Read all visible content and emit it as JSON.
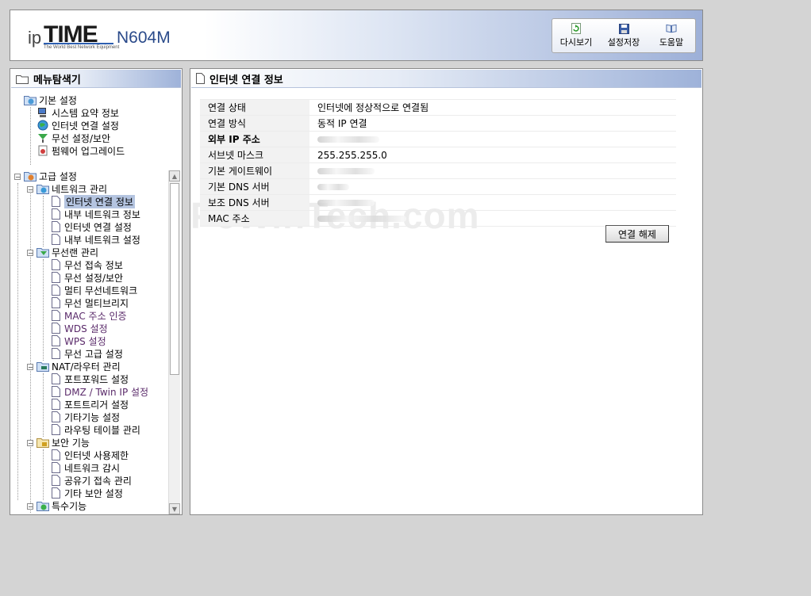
{
  "brand": {
    "prefix": "ip",
    "name": "TIME",
    "model": "N604M",
    "tagline": "The World Best Network Equipment"
  },
  "toolbar": {
    "refresh": "다시보기",
    "save": "설정저장",
    "help": "도움말"
  },
  "sidebar": {
    "title": "메뉴탐색기",
    "basic": {
      "label": "기본 설정",
      "items": [
        "시스템 요약 정보",
        "인터넷 연결 설정",
        "무선 설정/보안",
        "펌웨어 업그레이드"
      ]
    },
    "advanced": {
      "label": "고급 설정",
      "network": {
        "label": "네트워크 관리",
        "items": [
          "인터넷 연결 정보",
          "내부 네트워크 정보",
          "인터넷 연결 설정",
          "내부 네트워크 설정"
        ]
      },
      "wireless": {
        "label": "무선랜 관리",
        "items": [
          "무선 접속 정보",
          "무선 설정/보안",
          "멀티 무선네트워크",
          "무선 멀티브리지",
          "MAC 주소 인증",
          "WDS 설정",
          "WPS 설정",
          "무선 고급 설정"
        ]
      },
      "nat": {
        "label": "NAT/라우터 관리",
        "items": [
          "포트포워드 설정",
          "DMZ / Twin IP 설정",
          "포트트리거 설정",
          "기타기능 설정",
          "라우팅 테이블 관리"
        ]
      },
      "security": {
        "label": "보안 기능",
        "items": [
          "인터넷 사용제한",
          "네트워크 감시",
          "공유기 접속 관리",
          "기타 보안 설정"
        ]
      },
      "special": {
        "label": "특수기능"
      }
    }
  },
  "main": {
    "title": "인터넷 연결 정보",
    "rows": [
      {
        "key": "연결 상태",
        "value": "인터넷에 정상적으로 연결됨"
      },
      {
        "key": "연결 방식",
        "value": "동적 IP 연결"
      },
      {
        "key": "외부 IP 주소",
        "value": ""
      },
      {
        "key": "서브넷 마스크",
        "value": "255.255.255.0"
      },
      {
        "key": "기본 게이트웨이",
        "value": ""
      },
      {
        "key": "기본 DNS 서버",
        "value": ""
      },
      {
        "key": "보조 DNS 서버",
        "value": ""
      },
      {
        "key": "MAC 주소",
        "value": ""
      }
    ],
    "disconnect": "연결 해제",
    "watermark": "PcWinTech.com"
  },
  "colors": {
    "selection": "#b4c4e0",
    "title_gradient_end": "#9eb2d9"
  }
}
